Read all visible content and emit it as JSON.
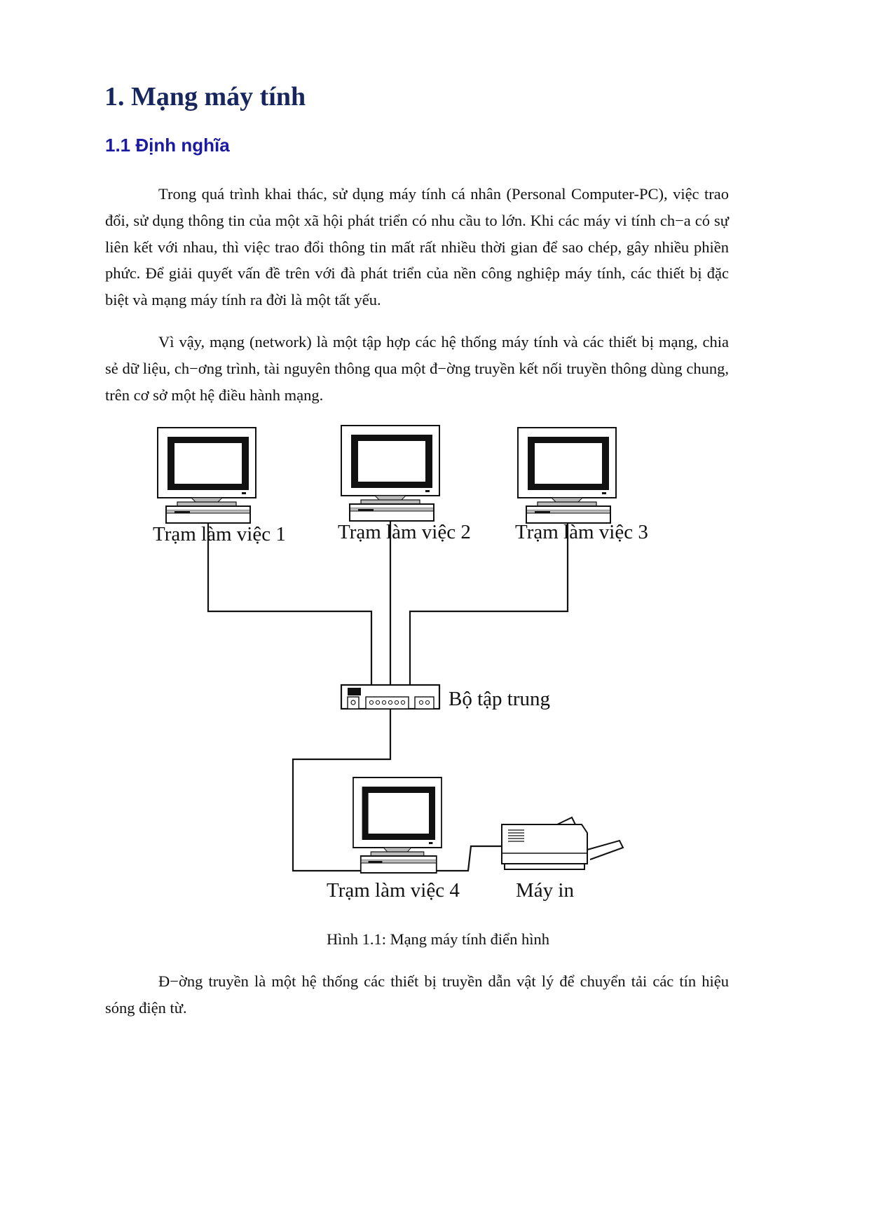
{
  "document": {
    "title": "1. Mạng máy tính",
    "section_heading": "1.1 Định nghĩa",
    "paragraphs": [
      "Trong quá trình khai thác, sử dụng máy tính cá nhân (Personal Computer-PC), việc trao đổi, sử dụng thông tin của một xã hội phát triển có nhu cầu to lớn. Khi các máy vi tính ch−a có sự liên kết với nhau, thì việc trao đổi thông tin mất rất nhiều thời gian để sao chép, gây nhiều phiền phức. Để giải quyết vấn đề trên với đà phát triển của nền công nghiệp máy tính, các thiết bị đặc biệt và mạng máy tính ra đời là một tất yếu.",
      "Vì vậy, mạng (network) là một tập hợp các hệ thống máy tính và các thiết bị mạng, chia sẻ dữ liệu, ch−ơng trình, tài nguyên thông qua một đ−ờng truyền kết nối truyền thông dùng chung, trên cơ sở một hệ điều hành mạng.",
      "Đ−ờng truyền là một hệ thống các thiết bị truyền dẫn vật lý để chuyển tải các tín hiệu sóng điện từ."
    ],
    "figure": {
      "caption": "Hình 1.1: Mạng máy tính điển hình",
      "nodes": {
        "ws1": "Trạm làm việc 1",
        "ws2": "Trạm làm việc 2",
        "ws3": "Trạm làm việc 3",
        "hub": "Bộ tập trung",
        "ws4": "Trạm làm việc 4",
        "printer": "Máy in"
      },
      "icons": {
        "workstation": "computer-monitor-icon",
        "hub": "network-hub-icon",
        "printer": "printer-icon"
      }
    },
    "colors": {
      "title": "#17265e",
      "section_heading": "#1b1aa0",
      "body_text": "#111111"
    }
  }
}
